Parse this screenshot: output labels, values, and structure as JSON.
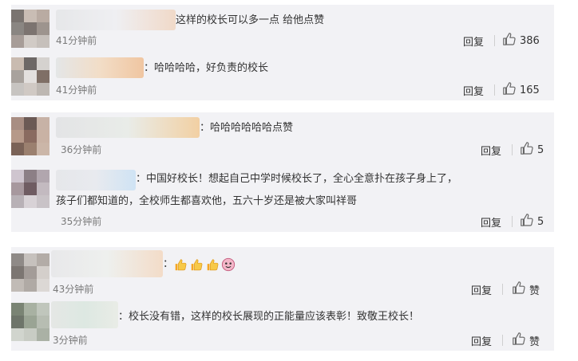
{
  "groups": [
    {
      "comments": [
        {
          "text": "这样的校长可以多一点 给他点赞",
          "time": "41分钟前",
          "reply": "回复",
          "likes": "386",
          "avatar_colors": [
            "#7a7470",
            "#c9bdb4",
            "#b9aba2",
            "#8a8682",
            "#7c7470",
            "#9d948e",
            "#a79d98",
            "#d1cbc6",
            "#c6c0bb"
          ],
          "name_colors": [
            "#e6e7e9",
            "#efeff2",
            "#f0d9c8"
          ]
        },
        {
          "text": "：哈哈哈哈，好负责的校长",
          "time": "41分钟前",
          "reply": "回复",
          "likes": "165",
          "avatar_colors": [
            "#c9bbb0",
            "#6d6866",
            "#d5d2cf",
            "#a8a29d",
            "#e3e0de",
            "#7f6f66",
            "#c7c4c1",
            "#d0c9c4",
            "#bdb7b2"
          ],
          "name_colors": [
            "#e4e6e7",
            "#f2ddc7",
            "#f0c6a1"
          ]
        }
      ]
    },
    {
      "comments": [
        {
          "text": "：哈哈哈哈哈哈点赞",
          "time": "36分钟前",
          "reply": "回复",
          "likes": "5",
          "avatar_colors": [
            "#a88e83",
            "#6b5a55",
            "#c7b2a6",
            "#b69989",
            "#8a6b60",
            "#c9b2a4",
            "#7a6257",
            "#9b806f",
            "#cbb6a8"
          ],
          "name_colors": [
            "#e3e4e6",
            "#e9ece8",
            "#f2d0a3"
          ]
        },
        {
          "text": "：中国好校长！想起自己中学时候校长了，全心全意扑在孩子身上了，孩子们都知道的，全校师生都喜欢他，五六十岁还是被大家叫祥哥",
          "time": "35分钟前",
          "reply": "回复",
          "likes": "5",
          "avatar_colors": [
            "#cfc5cf",
            "#8c7f86",
            "#b1a6ae",
            "#a7989e",
            "#6f5c62",
            "#c3bac0",
            "#b8b1b6",
            "#d8d2d6",
            "#c9c3c7"
          ],
          "name_colors": [
            "#e6e7ea",
            "#e8eaef",
            "#cfe3f4"
          ]
        }
      ]
    },
    {
      "comments": [
        {
          "text": "：",
          "time": "43分钟前",
          "reply": "回复",
          "likes": "赞",
          "emojis": [
            "thumbs-up",
            "thumbs-up",
            "thumbs-up",
            "pink-face"
          ],
          "avatar_colors": [
            "#8f8a87",
            "#c6c1bd",
            "#b3aca7",
            "#7c7672",
            "#a39c98",
            "#d4cfcb",
            "#c1bbb6",
            "#b0aaa5",
            "#dcd8d5"
          ],
          "name_colors": [
            "#e8e8ea",
            "#eef0ee",
            "#f3dcc8"
          ]
        },
        {
          "text": "：校长没有错，这样的校长展现的正能量应该表彰！致敬王校长！",
          "time": "3分钟前",
          "reply": "回复",
          "likes": "赞",
          "avatar_colors": [
            "#7a8474",
            "#a8b1a2",
            "#c0c6bc",
            "#6e756a",
            "#9aa494",
            "#b7bdb2",
            "#d1d5ce",
            "#c8ccc4",
            "#aab1a5"
          ],
          "name_colors": [
            "#e5e7e5",
            "#dde8e2",
            "#e9ece6"
          ]
        }
      ]
    }
  ]
}
